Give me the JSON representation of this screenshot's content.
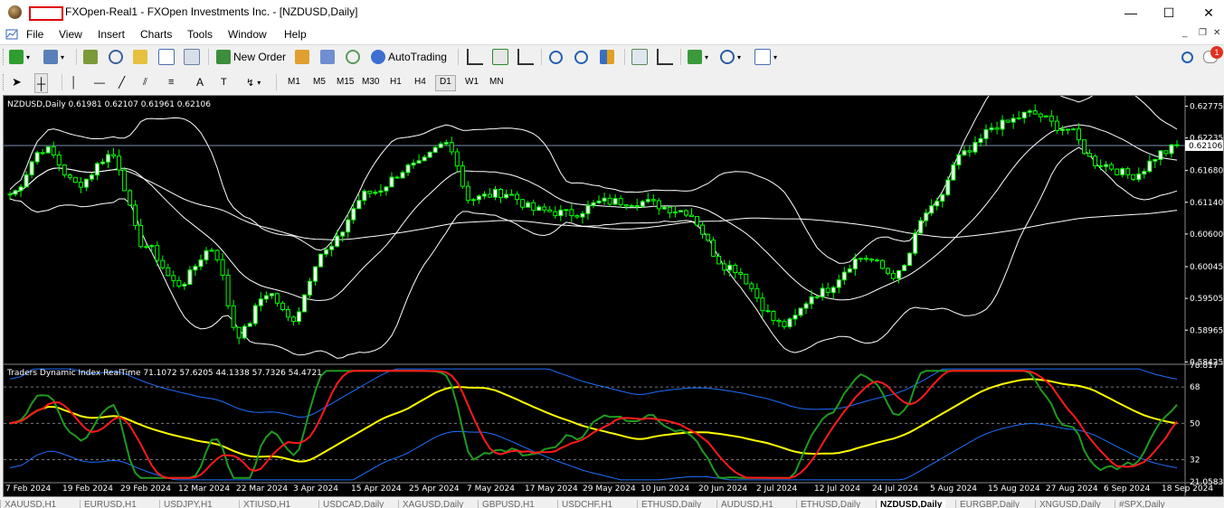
{
  "window": {
    "title": "FXOpen-Real1 - FXOpen Investments Inc. - [NZDUSD,Daily]",
    "minimize": "—",
    "maximize": "☐",
    "close": "✕"
  },
  "menu": {
    "items": [
      "File",
      "View",
      "Insert",
      "Charts",
      "Tools",
      "Window",
      "Help"
    ]
  },
  "toolbar": {
    "new_order": "New Order",
    "autotrading": "AutoTrading",
    "notification_count": "1"
  },
  "timeframes": [
    "M1",
    "M5",
    "M15",
    "M30",
    "H1",
    "H4",
    "D1",
    "W1",
    "MN"
  ],
  "active_timeframe": "D1",
  "chart": {
    "header": "NZDUSD,Daily  0.61981 0.62107 0.61961 0.62106",
    "current_price": "0.62106",
    "price_ticks": [
      "0.62775",
      "0.62235",
      "0.61680",
      "0.61140",
      "0.60600",
      "0.60045",
      "0.59505",
      "0.58965",
      "0.58425"
    ],
    "indicator_header": "Traders Dynamic Index RealTime 71.1072 57.6205 44.1338 57.7326 54.4721",
    "indicator_ticks": [
      "78.817",
      "68",
      "50",
      "32",
      "21.0583"
    ],
    "date_labels": [
      "7 Feb 2024",
      "19 Feb 2024",
      "29 Feb 2024",
      "12 Mar 2024",
      "22 Mar 2024",
      "3 Apr 2024",
      "15 Apr 2024",
      "25 Apr 2024",
      "7 May 2024",
      "17 May 2024",
      "29 May 2024",
      "10 Jun 2024",
      "20 Jun 2024",
      "2 Jul 2024",
      "12 Jul 2024",
      "24 Jul 2024",
      "5 Aug 2024",
      "15 Aug 2024",
      "27 Aug 2024",
      "6 Sep 2024",
      "18 Sep 2024"
    ]
  },
  "tabs": [
    "XAUUSD,H1",
    "EURUSD,H1",
    "USDJPY,H1",
    "XTIUSD,H1",
    "USDCAD,Daily",
    "XAGUSD,Daily",
    "GBPUSD,H1",
    "USDCHF,H1",
    "ETHUSD,Daily",
    "AUDUSD,H1",
    "ETHUSD,Daily",
    "NZDUSD,Daily",
    "EURGBP,Daily",
    "XNGUSD,Daily",
    "#SPX,Daily"
  ],
  "colors": {
    "candle": "#00ff00",
    "band": "#ffffff",
    "tdi_green": "#1f9a1f",
    "tdi_red": "#ff1a1a",
    "tdi_yellow": "#ffff00",
    "tdi_blue": "#1e6fff"
  }
}
